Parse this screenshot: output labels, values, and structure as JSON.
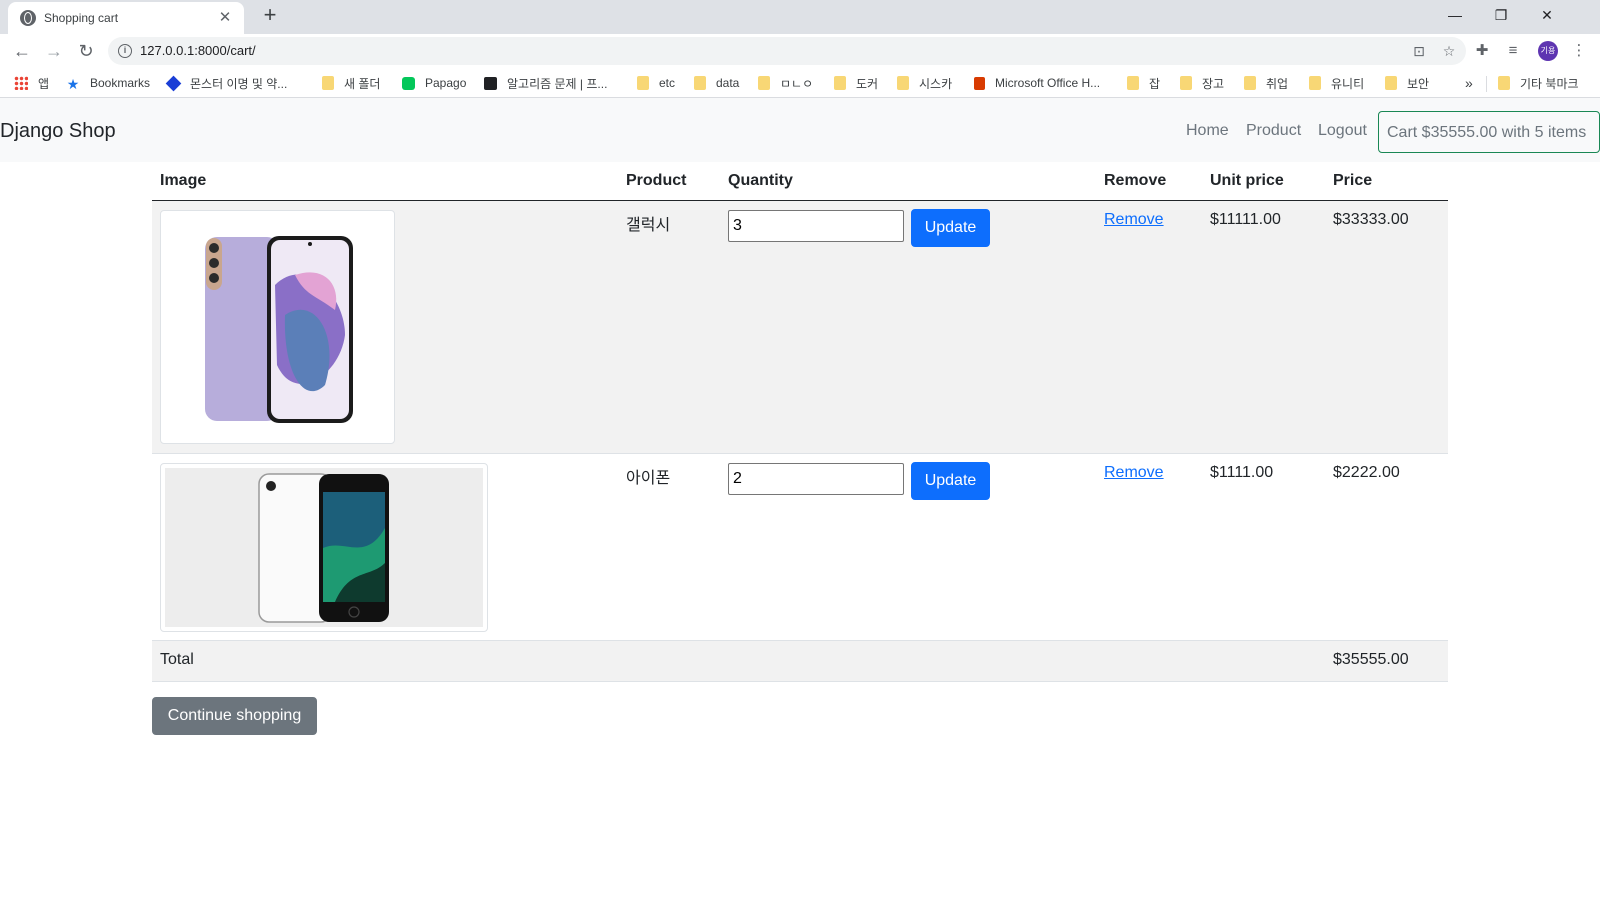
{
  "browser": {
    "tab_title": "Shopping cart",
    "tab_close": "✕",
    "new_tab": "+",
    "url": "127.0.0.1:8000/cart/",
    "window_controls": {
      "minimize": "—",
      "restore": "❐",
      "close": "✕"
    },
    "profile_initials": "기용",
    "bookmarks": [
      {
        "label": "앱",
        "icon": "apps-icon"
      },
      {
        "label": "Bookmarks",
        "icon": "star-icon"
      },
      {
        "label": "몬스터 이명 및 약...",
        "icon": "cube-icon"
      },
      {
        "label": "새 폴더",
        "icon": "folder-icon"
      },
      {
        "label": "Papago",
        "icon": "papago-icon"
      },
      {
        "label": "알고리즘 문제 | 프...",
        "icon": "checkmark-icon"
      },
      {
        "label": "etc",
        "icon": "folder-icon"
      },
      {
        "label": "data",
        "icon": "folder-icon"
      },
      {
        "label": "ㅁㄴㅇ",
        "icon": "folder-icon"
      },
      {
        "label": "도커",
        "icon": "folder-icon"
      },
      {
        "label": "시스카",
        "icon": "folder-icon"
      },
      {
        "label": "Microsoft Office H...",
        "icon": "office-icon"
      },
      {
        "label": "잡",
        "icon": "folder-icon"
      },
      {
        "label": "장고",
        "icon": "folder-icon"
      },
      {
        "label": "취업",
        "icon": "folder-icon"
      },
      {
        "label": "유니티",
        "icon": "folder-icon"
      },
      {
        "label": "보안",
        "icon": "folder-icon"
      }
    ],
    "bookmarks_overflow": "»",
    "other_bookmarks": "기타 북마크"
  },
  "site": {
    "brand": "Django Shop",
    "nav": {
      "home": "Home",
      "product": "Product",
      "logout": "Logout"
    },
    "cart_summary": "Cart $35555.00 with 5 items"
  },
  "table": {
    "headers": {
      "image": "Image",
      "product": "Product",
      "quantity": "Quantity",
      "remove": "Remove",
      "unit_price": "Unit price",
      "price": "Price"
    },
    "rows": [
      {
        "product": "갤럭시",
        "quantity": "3",
        "update_label": "Update",
        "remove_label": "Remove",
        "unit_price": "$11111.00",
        "price": "$33333.00"
      },
      {
        "product": "아이폰",
        "quantity": "2",
        "update_label": "Update",
        "remove_label": "Remove",
        "unit_price": "$1111.00",
        "price": "$2222.00"
      }
    ],
    "total_label": "Total",
    "total_value": "$35555.00"
  },
  "continue_label": "Continue shopping",
  "colors": {
    "primary": "#0d6efd",
    "secondary": "#6c757d",
    "success_border": "#198754",
    "row_striped": "#f2f2f2",
    "navbar_bg": "#f8f9fa"
  }
}
